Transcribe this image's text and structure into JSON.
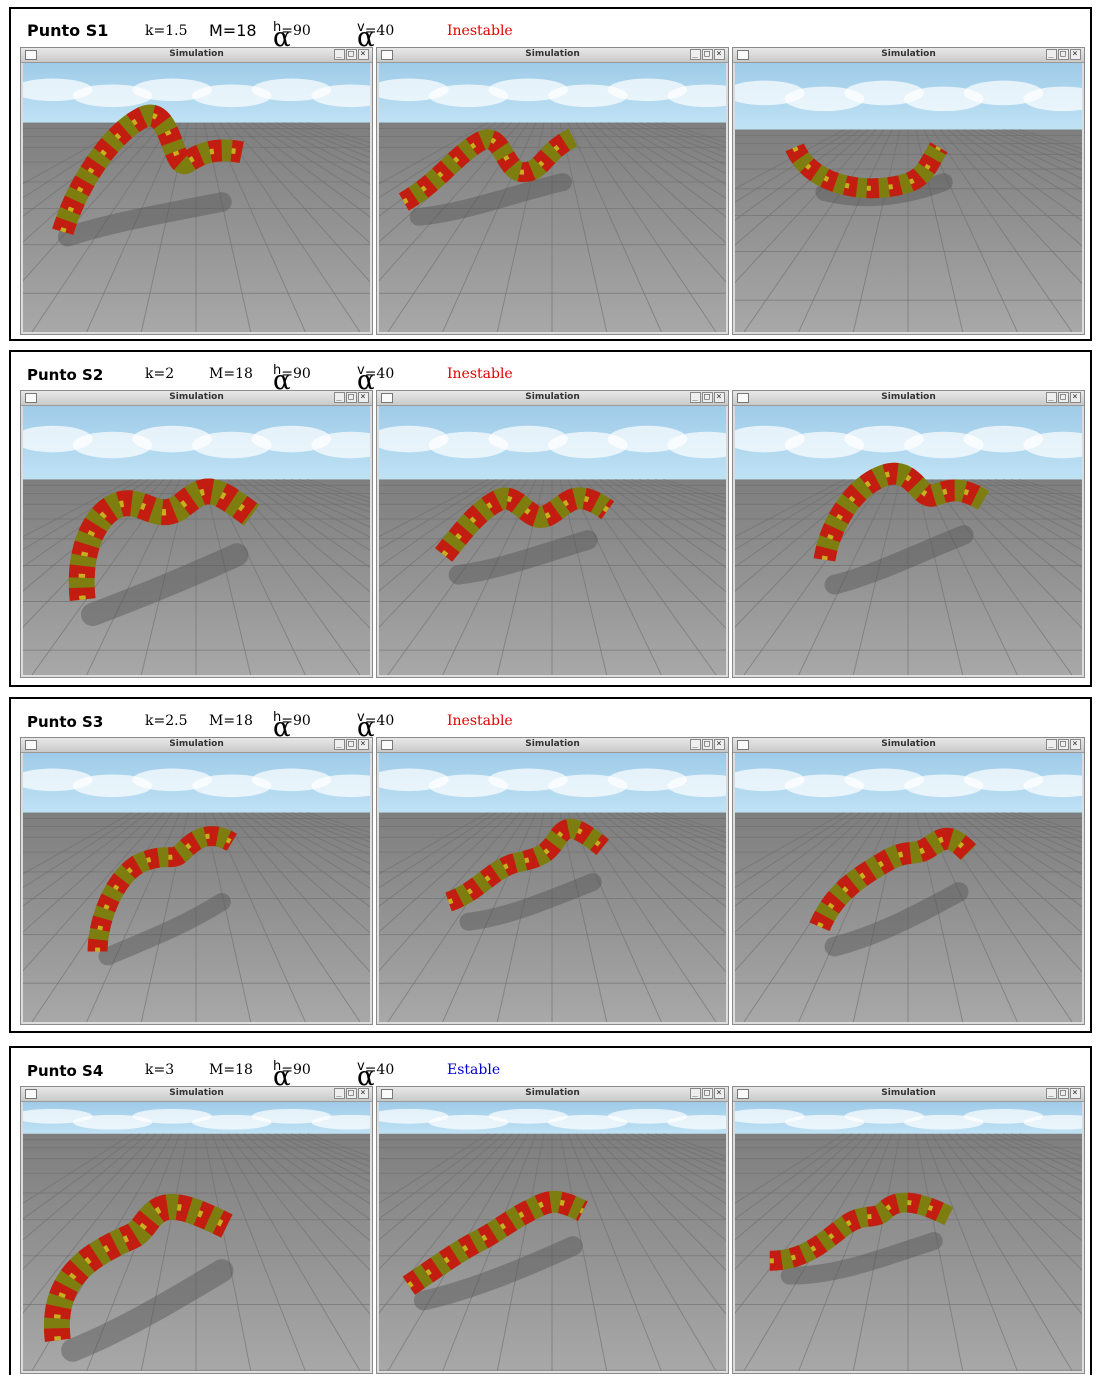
{
  "window_title": "Simulation",
  "window_controls": {
    "minimize": "_",
    "maximize": "□",
    "close": "×"
  },
  "alpha_symbol": "α",
  "panels": [
    {
      "point": "Punto S1",
      "k": "k=1.5",
      "m": "M=18",
      "alpha_h_sub": "h",
      "alpha_h_val": "=90",
      "alpha_v_sub": "v",
      "alpha_v_val": "=40",
      "status": "Inestable",
      "status_color": "#e00000"
    },
    {
      "point": "Punto S2",
      "k": "k=2",
      "m": "M=18",
      "alpha_h_sub": "h",
      "alpha_h_val": "=90",
      "alpha_v_sub": "v",
      "alpha_v_val": "=40",
      "status": "Inestable",
      "status_color": "#e00000"
    },
    {
      "point": "Punto S3",
      "k": "k=2.5",
      "m": "M=18",
      "alpha_h_sub": "h",
      "alpha_h_val": "=90",
      "alpha_v_sub": "v",
      "alpha_v_val": "=40",
      "status": "Inestable",
      "status_color": "#e00000"
    },
    {
      "point": "Punto S4",
      "k": "k=3",
      "m": "M=18",
      "alpha_h_sub": "h",
      "alpha_h_val": "=90",
      "alpha_v_sub": "v",
      "alpha_v_val": "=40",
      "status": "Estable",
      "status_color": "#0000cc"
    }
  ],
  "colors": {
    "sky": "#bfe2f5",
    "floor": "#8c8c8c",
    "snake_red": "#c21d10",
    "snake_olive": "#7d7d10",
    "snake_yellow": "#c8c020"
  }
}
